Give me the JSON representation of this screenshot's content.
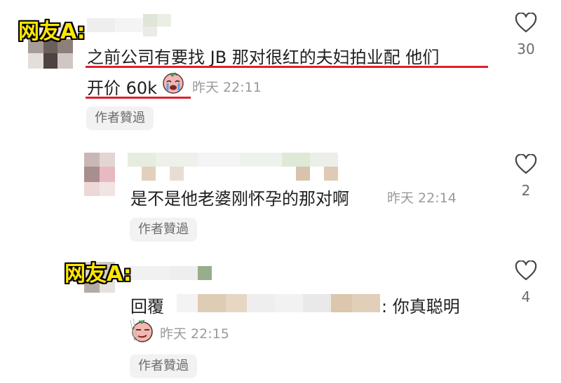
{
  "annotations": {
    "tag_label": "网友A:",
    "underline_color": "#e0202a"
  },
  "comments": [
    {
      "text_line1": "之前公司有要找 JB 那对很红的夫妇拍业配 他们",
      "text_line2": "开价 60k",
      "sticker_icon": "crying-baby-sticker",
      "time": "昨天 22:11",
      "chip": "作者贊過",
      "likes": "30"
    },
    {
      "text": "是不是他老婆刚怀孕的那对啊",
      "time": "昨天 22:14",
      "chip": "作者贊過",
      "likes": "2"
    },
    {
      "reply_prefix": "回覆",
      "text_suffix": ": 你真聪明",
      "sticker_icon": "smirking-face-sticker",
      "time": "昨天 22:15",
      "chip": "作者贊過",
      "likes": "4"
    }
  ]
}
